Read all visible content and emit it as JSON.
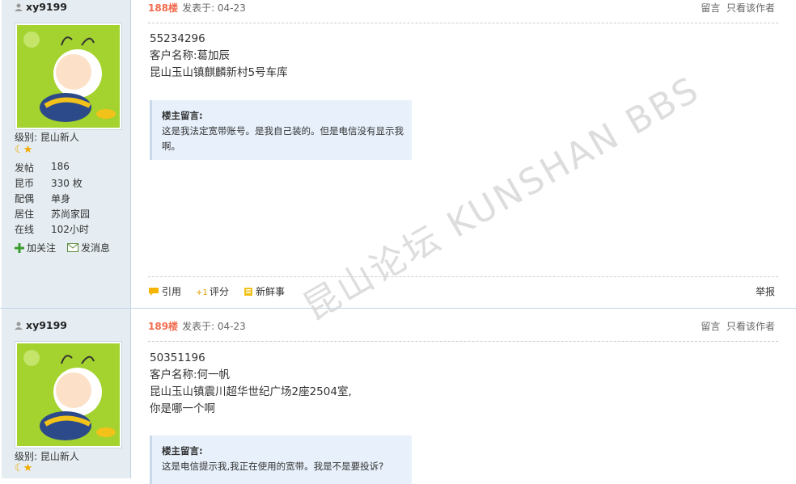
{
  "posts": [
    {
      "username": "xy9199",
      "rank": "级别: 昆山新人",
      "stars": "☾★",
      "stats": [
        {
          "k": "发帖",
          "v": "186"
        },
        {
          "k": "昆币",
          "v": "330 枚"
        },
        {
          "k": "配偶",
          "v": "单身"
        },
        {
          "k": "居住",
          "v": "苏尚家园"
        },
        {
          "k": "在线",
          "v": "102小时"
        }
      ],
      "follow": "加关注",
      "message": "发消息",
      "floor": "188楼",
      "posted": "发表于: 04-23",
      "reply": "留言",
      "only_author": "只看该作者",
      "lines": [
        "55234296",
        "客户名称:葛加辰",
        "昆山玉山镇麒麟新村5号车库"
      ],
      "quote_title": "楼主留言:",
      "quote_text": "这是我法定宽带账号。是我自己装的。但是电信没有显示我啊。",
      "quote_action": "引用",
      "rate_action": "评分",
      "fresh_action": "新鲜事",
      "report": "举报"
    },
    {
      "username": "xy9199",
      "rank": "级别: 昆山新人",
      "stars": "☾★",
      "floor": "189楼",
      "posted": "发表于: 04-23",
      "reply": "留言",
      "only_author": "只看该作者",
      "lines": [
        "50351196",
        "客户名称:何一帆",
        "昆山玉山镇震川超华世纪广场2座2504室,",
        "你是哪一个啊"
      ],
      "quote_title": "楼主留言:",
      "quote_text": "这是电信提示我,我正在使用的宽带。我是不是要投诉?"
    }
  ],
  "watermark": "昆山论坛 KUNSHAN BBS"
}
